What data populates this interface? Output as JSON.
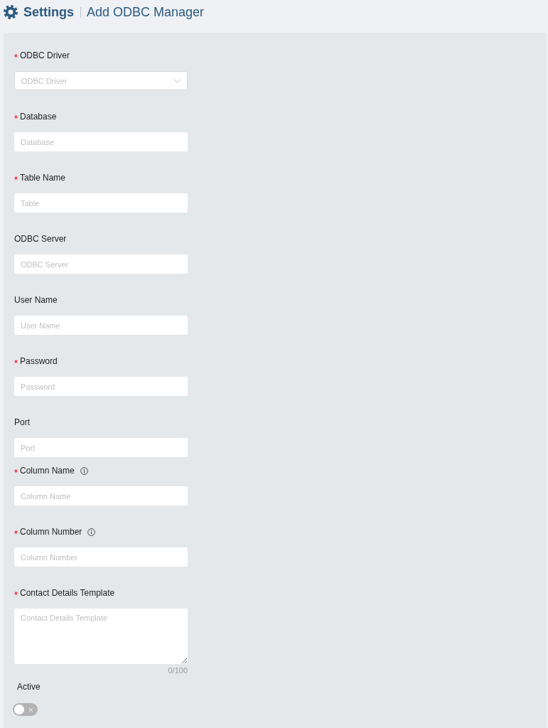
{
  "header": {
    "title": "Settings",
    "subtitle": "Add ODBC Manager"
  },
  "fields": [
    {
      "kind": "select",
      "label": "ODBC Driver",
      "required": true,
      "info": false,
      "placeholder": "ODBC Driver"
    },
    {
      "kind": "input",
      "label": "Database",
      "required": true,
      "info": false,
      "placeholder": "Database"
    },
    {
      "kind": "input",
      "label": "Table Name",
      "required": true,
      "info": false,
      "placeholder": "Table"
    },
    {
      "kind": "input",
      "label": "ODBC Server",
      "required": false,
      "info": false,
      "placeholder": "ODBC Server"
    },
    {
      "kind": "input",
      "label": "User Name",
      "required": false,
      "info": false,
      "placeholder": "User Name"
    },
    {
      "kind": "input",
      "label": "Password",
      "required": true,
      "info": false,
      "placeholder": "Password"
    },
    {
      "kind": "input",
      "label": "Port",
      "required": false,
      "info": false,
      "placeholder": "Port"
    },
    {
      "kind": "input",
      "label": "Column Name",
      "required": true,
      "info": true,
      "placeholder": "Column Name"
    },
    {
      "kind": "input",
      "label": "Column Number",
      "required": true,
      "info": true,
      "placeholder": "Column Number"
    },
    {
      "kind": "textarea",
      "label": "Contact Details Template",
      "required": true,
      "info": false,
      "placeholder": "Contact Details Template",
      "counter": "0/100"
    }
  ],
  "active": {
    "label": "Active",
    "on": false
  }
}
